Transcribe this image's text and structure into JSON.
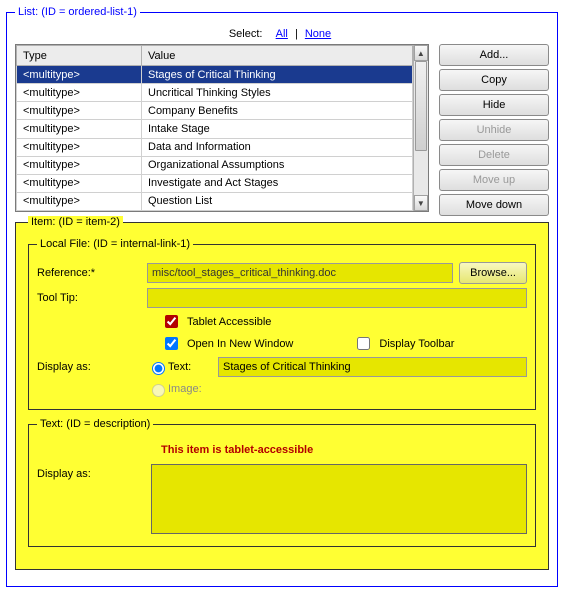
{
  "list": {
    "legend": "List: (ID = ordered-list-1)",
    "select_label": "Select:",
    "all": "All",
    "none": "None",
    "headers": {
      "type": "Type",
      "value": "Value"
    },
    "rows": [
      {
        "type": "<multitype>",
        "value": "Stages of Critical Thinking",
        "selected": true
      },
      {
        "type": "<multitype>",
        "value": "Uncritical Thinking Styles"
      },
      {
        "type": "<multitype>",
        "value": "Company Benefits"
      },
      {
        "type": "<multitype>",
        "value": "Intake Stage"
      },
      {
        "type": "<multitype>",
        "value": "Data and Information"
      },
      {
        "type": "<multitype>",
        "value": "Organizational Assumptions"
      },
      {
        "type": "<multitype>",
        "value": "Investigate and Act Stages"
      },
      {
        "type": "<multitype>",
        "value": "Question List"
      }
    ]
  },
  "buttons": {
    "add": "Add...",
    "copy": "Copy",
    "hide": "Hide",
    "unhide": "Unhide",
    "delete": "Delete",
    "moveup": "Move up",
    "movedown": "Move down"
  },
  "item": {
    "legend": "Item: (ID = item-2)",
    "localfile": {
      "legend": "Local File: (ID = internal-link-1)",
      "reference_label": "Reference:*",
      "reference_value": "misc/tool_stages_critical_thinking.doc",
      "browse": "Browse...",
      "tooltip_label": "Tool Tip:",
      "tooltip_value": "",
      "tablet_accessible": "Tablet Accessible",
      "open_new_window": "Open In New Window",
      "display_toolbar": "Display Toolbar",
      "display_as": "Display as:",
      "text_label": "Text:",
      "text_value": "Stages of Critical Thinking",
      "image_label": "Image:"
    },
    "textfs": {
      "legend": "Text: (ID = description)",
      "message": "This item is tablet-accessible",
      "display_as": "Display as:",
      "textarea_value": ""
    }
  }
}
